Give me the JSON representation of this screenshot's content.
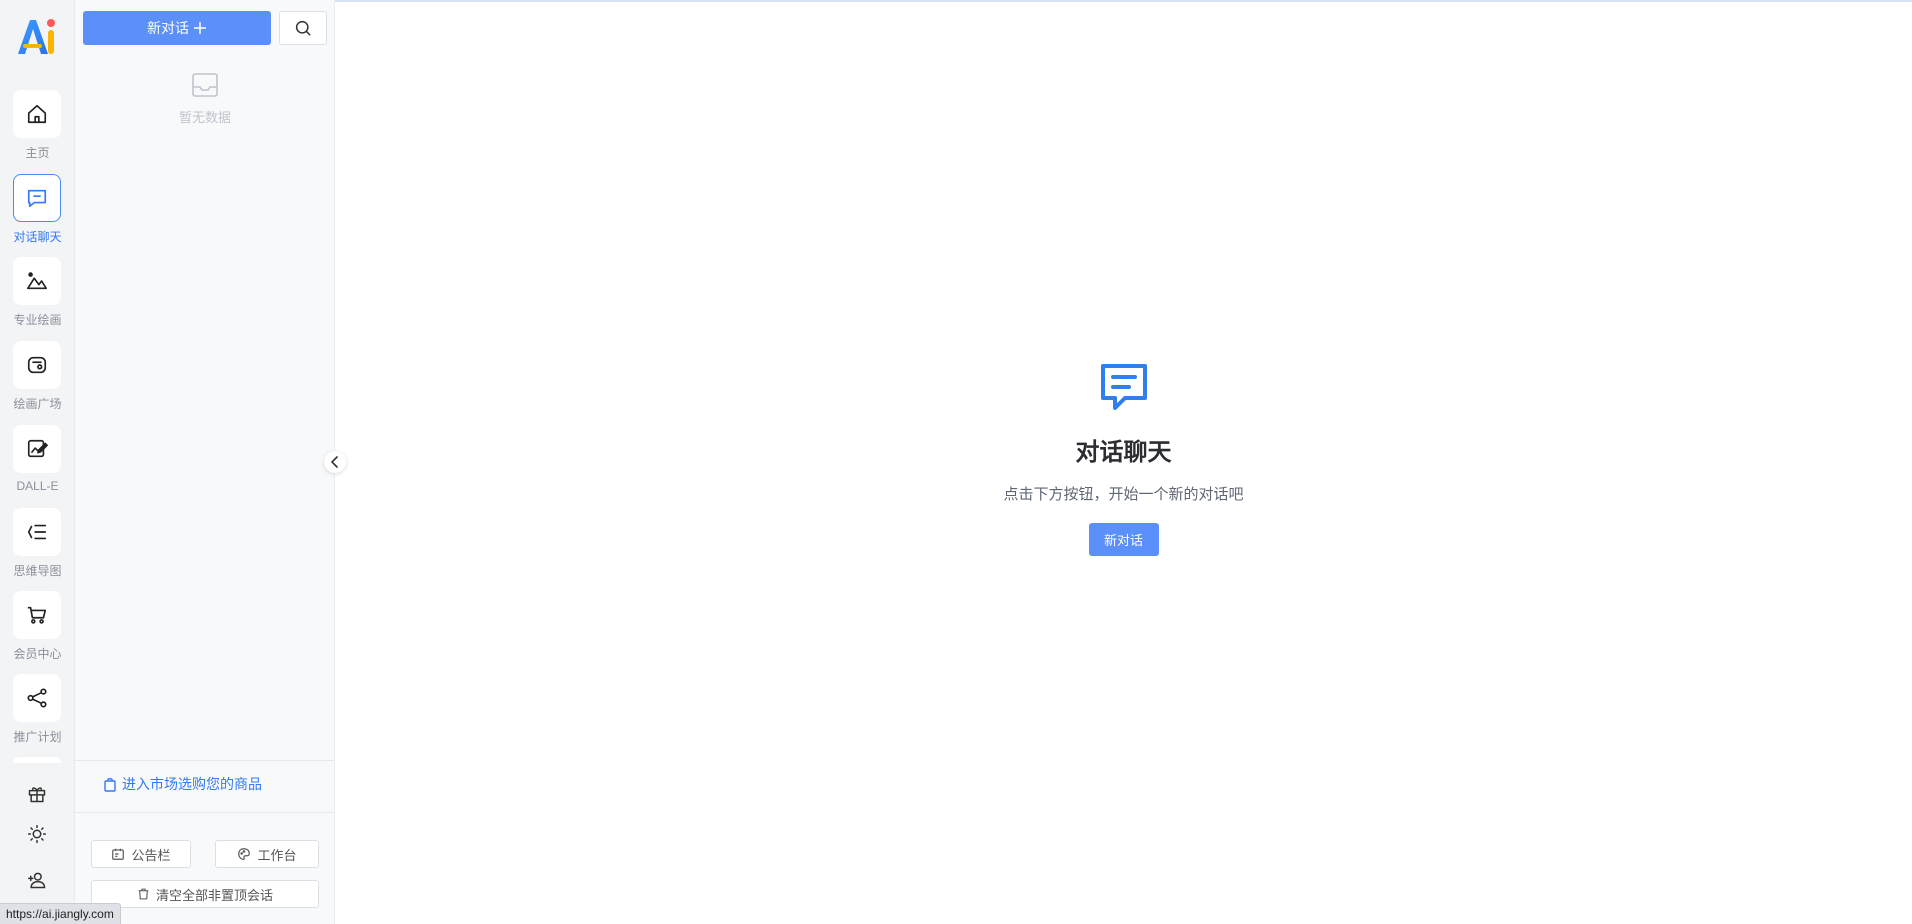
{
  "sidebar": {
    "logo_text": "Ai",
    "items": [
      {
        "label": "主页",
        "icon": "home-icon",
        "active": false
      },
      {
        "label": "对话聊天",
        "icon": "chat-icon",
        "active": true
      },
      {
        "label": "专业绘画",
        "icon": "mountain-icon",
        "active": false
      },
      {
        "label": "绘画广场",
        "icon": "gallery-icon",
        "active": false
      },
      {
        "label": "DALL-E",
        "icon": "edit-image-icon",
        "active": false
      },
      {
        "label": "思维导图",
        "icon": "mindmap-icon",
        "active": false
      },
      {
        "label": "会员中心",
        "icon": "cart-icon",
        "active": false
      },
      {
        "label": "推广计划",
        "icon": "share-icon",
        "active": false
      }
    ],
    "bottom_icons": [
      "gift-icon",
      "sun-icon",
      "user-add-icon"
    ]
  },
  "panel": {
    "new_chat_label": "新对话",
    "empty_text": "暂无数据",
    "market_link": "进入市场选购您的商品",
    "notice_label": "公告栏",
    "workbench_label": "工作台",
    "clear_label": "清空全部非置顶会话"
  },
  "main": {
    "title": "对话聊天",
    "subtitle": "点击下方按钮，开始一个新的对话吧",
    "button_label": "新对话"
  },
  "status_bar": {
    "url": "https://ai.jiangly.com"
  },
  "colors": {
    "accent": "#5b8ff9",
    "active_blue": "#3478f6",
    "panel_bg": "#f8f9fb",
    "rail_bg": "#f3f4f6"
  }
}
